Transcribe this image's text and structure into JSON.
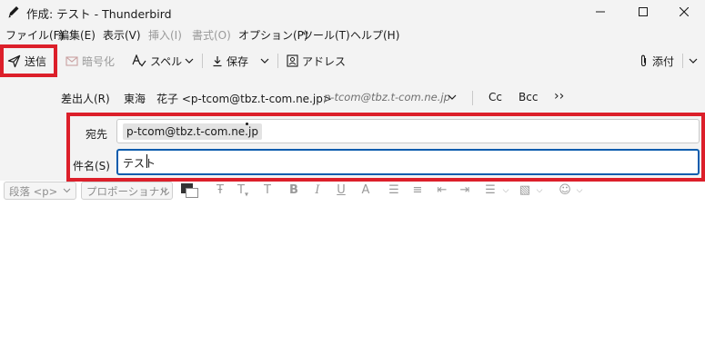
{
  "window": {
    "title": "作成: テスト - Thunderbird"
  },
  "menubar": {
    "items": [
      {
        "label": "ファイル(F)",
        "enabled": true
      },
      {
        "label": "編集(E)",
        "enabled": true
      },
      {
        "label": "表示(V)",
        "enabled": true
      },
      {
        "label": "挿入(I)",
        "enabled": false
      },
      {
        "label": "書式(O)",
        "enabled": false
      },
      {
        "label": "オプション(P)",
        "enabled": true
      },
      {
        "label": "ツール(T)",
        "enabled": true
      },
      {
        "label": "ヘルプ(H)",
        "enabled": true
      }
    ]
  },
  "toolbar": {
    "send_label": "送信",
    "encrypt_label": "暗号化",
    "spell_label": "スペル",
    "save_label": "保存",
    "address_label": "アドレス",
    "attach_label": "添付"
  },
  "header": {
    "from_label": "差出人(R)",
    "from_value": "東海　花子 <p-tcom@tbz.t-com.ne.jp>",
    "from_alt": "p-tcom@tbz.t-com.ne.jp",
    "cc_label": "Cc",
    "bcc_label": "Bcc",
    "more_label": "››",
    "to_label": "宛先",
    "to_recipient": "p-tcom@tbz.t-com.ne.jp",
    "subject_label": "件名(S)",
    "subject_value": "テスト"
  },
  "format": {
    "paragraph_format": "段落 <p>",
    "font_family": "プロポーショナル"
  },
  "colors": {
    "highlight": "#dc1f2a",
    "focus": "#0b5cad",
    "chrome": "#f3f3f3"
  }
}
